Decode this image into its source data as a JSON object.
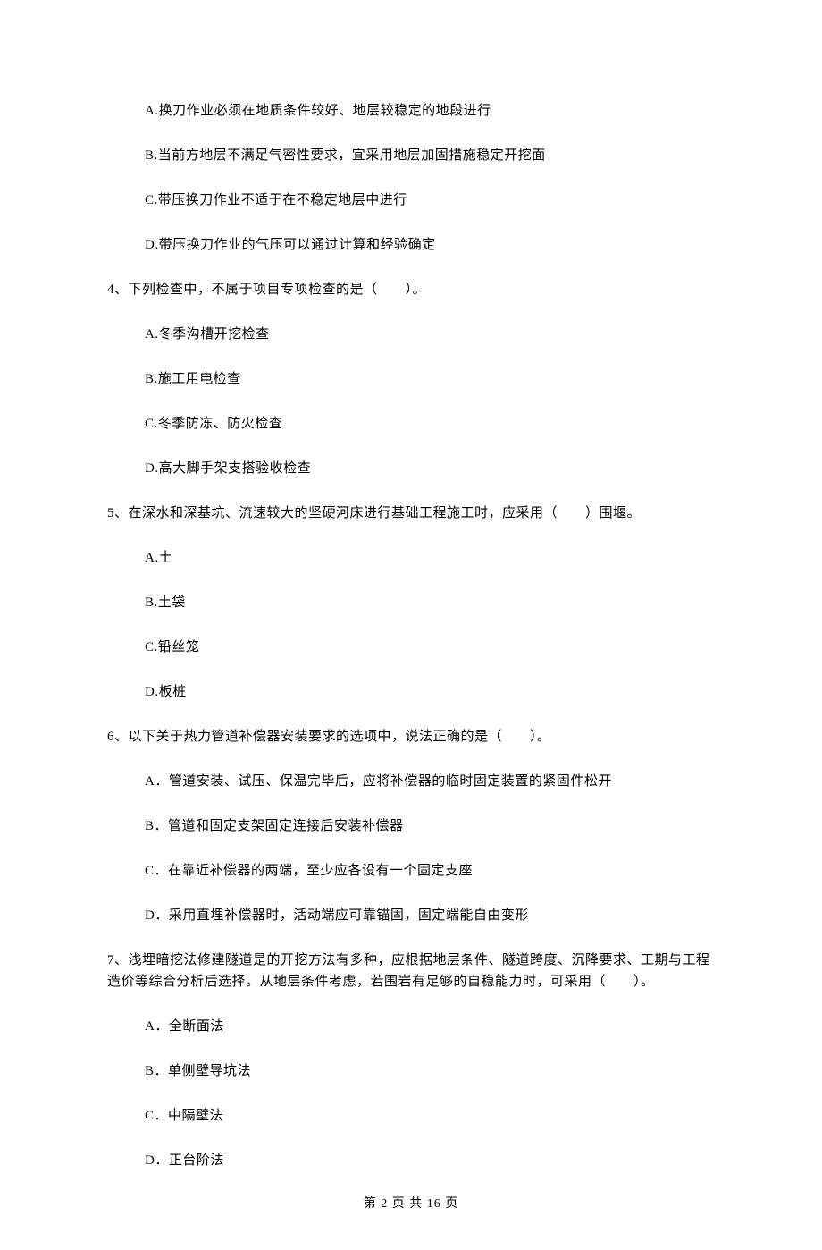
{
  "q3": {
    "optA": "A.换刀作业必须在地质条件较好、地层较稳定的地段进行",
    "optB": "B.当前方地层不满足气密性要求，宜采用地层加固措施稳定开挖面",
    "optC": "C.带压换刀作业不适于在不稳定地层中进行",
    "optD": "D.带压换刀作业的气压可以通过计算和经验确定"
  },
  "q4": {
    "stem": "4、下列检查中，不属于项目专项检查的是（　　）。",
    "optA": "A.冬季沟槽开挖检查",
    "optB": "B.施工用电检查",
    "optC": "C.冬季防冻、防火检查",
    "optD": "D.高大脚手架支搭验收检查"
  },
  "q5": {
    "stem": "5、在深水和深基坑、流速较大的坚硬河床进行基础工程施工时，应采用（　　）围堰。",
    "optA": "A.土",
    "optB": "B.土袋",
    "optC": "C.铅丝笼",
    "optD": "D.板桩"
  },
  "q6": {
    "stem": "6、以下关于热力管道补偿器安装要求的选项中，说法正确的是（　　）。",
    "optA": "A．管道安装、试压、保温完毕后，应将补偿器的临时固定装置的紧固件松开",
    "optB": "B．管道和固定支架固定连接后安装补偿器",
    "optC": "C．在靠近补偿器的两端，至少应各设有一个固定支座",
    "optD": "D．采用直埋补偿器时，活动端应可靠锚固，固定端能自由变形"
  },
  "q7": {
    "stem": "7、浅埋暗挖法修建隧道是的开挖方法有多种，应根据地层条件、隧道跨度、沉降要求、工期与工程造价等综合分析后选择。从地层条件考虑，若围岩有足够的自稳能力时，可采用（　　）。",
    "optA": "A．全断面法",
    "optB": "B．单侧壁导坑法",
    "optC": "C．中隔壁法",
    "optD": "D．正台阶法"
  },
  "footer": "第 2 页 共 16 页"
}
